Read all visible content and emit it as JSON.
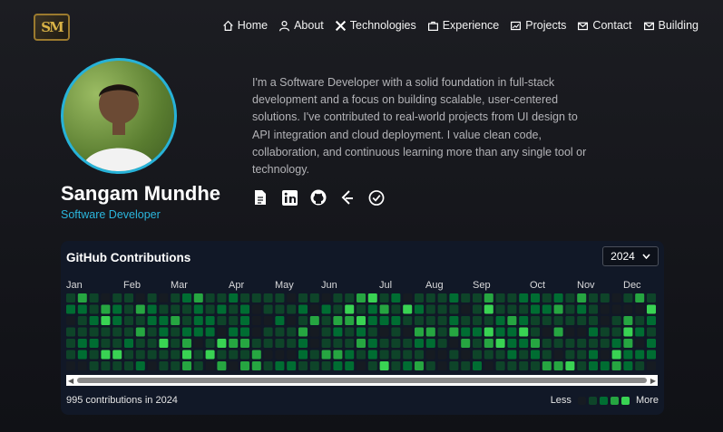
{
  "logo": {
    "text": "SM"
  },
  "nav": [
    {
      "label": "Home",
      "icon": "home-icon"
    },
    {
      "label": "About",
      "icon": "user-icon"
    },
    {
      "label": "Technologies",
      "icon": "tools-icon"
    },
    {
      "label": "Experience",
      "icon": "briefcase-icon"
    },
    {
      "label": "Projects",
      "icon": "projects-icon"
    },
    {
      "label": "Contact",
      "icon": "mail-icon"
    },
    {
      "label": "Building",
      "icon": "mail-icon"
    }
  ],
  "profile": {
    "name": "Sangam Mundhe",
    "role": "Software Developer",
    "bio": "I'm a Software Developer with a solid foundation in full-stack development and a focus on building scalable, user-centered solutions. I've contributed to real-world projects from UI design to API integration and cloud deployment. I value clean code, collaboration, and continuous learning more than any single tool or technology."
  },
  "socials": [
    "resume-icon",
    "linkedin-icon",
    "github-icon",
    "leetcode-icon",
    "check-circle-icon"
  ],
  "github": {
    "title": "GitHub Contributions",
    "year": "2024",
    "months": [
      "Jan",
      "Feb",
      "Mar",
      "Apr",
      "May",
      "Jun",
      "Jul",
      "Aug",
      "Sep",
      "Oct",
      "Nov",
      "Dec"
    ],
    "summary": "995 contributions in 2024",
    "legend_less": "Less",
    "legend_more": "More",
    "levels": [
      "#161b22",
      "#0e4429",
      "#006d32",
      "#26a641",
      "#39d353"
    ]
  }
}
